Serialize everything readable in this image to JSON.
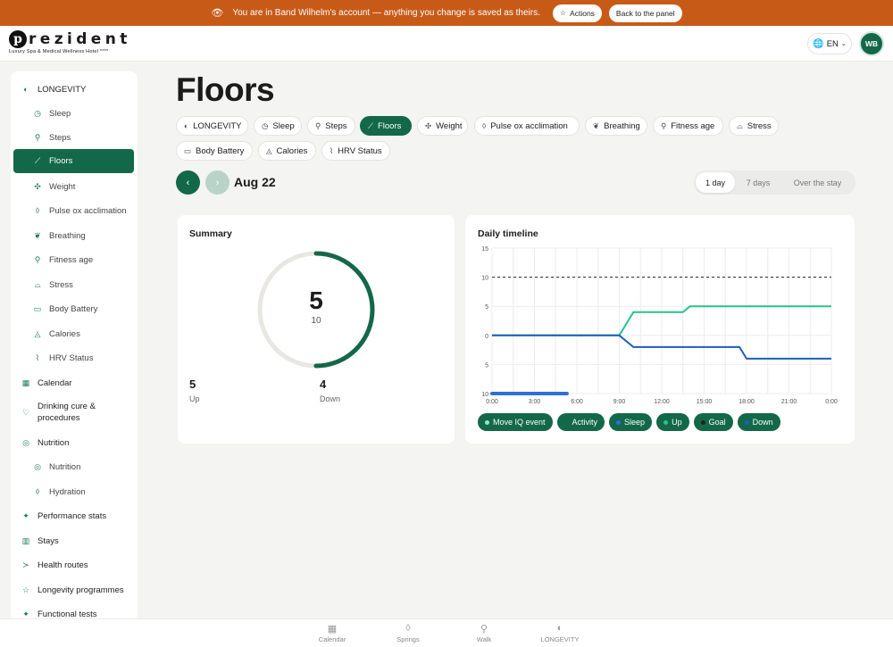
{
  "banner": {
    "message": "You are in Band Wilhelm's account — anything you change is saved as theirs.",
    "actions_label": "Actions",
    "back_label": "Back to the panel"
  },
  "header": {
    "logo_word": "rezident",
    "logo_sub": "Luxury Spa & Medical Wellness Hotel ****",
    "lang": "EN",
    "avatar": "WB"
  },
  "sidebar": {
    "items": [
      {
        "label": "LONGEVITY",
        "icon": "longevity-icon",
        "level": "top"
      },
      {
        "label": "Sleep",
        "icon": "clock-icon",
        "level": "sub"
      },
      {
        "label": "Steps",
        "icon": "walk-icon",
        "level": "sub"
      },
      {
        "label": "Floors",
        "icon": "stairs-icon",
        "level": "sub",
        "active": true
      },
      {
        "label": "Weight",
        "icon": "weight-icon",
        "level": "sub"
      },
      {
        "label": "Pulse ox acclimation",
        "icon": "drop-icon",
        "level": "sub"
      },
      {
        "label": "Breathing",
        "icon": "lungs-icon",
        "level": "sub"
      },
      {
        "label": "Fitness age",
        "icon": "run-icon",
        "level": "sub"
      },
      {
        "label": "Stress",
        "icon": "stress-icon",
        "level": "sub"
      },
      {
        "label": "Body Battery",
        "icon": "battery-icon",
        "level": "sub"
      },
      {
        "label": "Calories",
        "icon": "flame-icon",
        "level": "sub"
      },
      {
        "label": "HRV Status",
        "icon": "pulse-icon",
        "level": "sub"
      },
      {
        "label": "Calendar",
        "icon": "calendar-icon",
        "level": "top"
      },
      {
        "label": "Drinking cure & procedures",
        "icon": "heart-icon",
        "level": "top"
      },
      {
        "label": "Nutrition",
        "icon": "target-icon",
        "level": "top"
      },
      {
        "label": "Nutrition",
        "icon": "target-icon",
        "level": "sub"
      },
      {
        "label": "Hydration",
        "icon": "drop-icon",
        "level": "sub"
      },
      {
        "label": "Performance stats",
        "icon": "sparkle-icon",
        "level": "top"
      },
      {
        "label": "Stays",
        "icon": "building-icon",
        "level": "top"
      },
      {
        "label": "Health routes",
        "icon": "route-icon",
        "level": "top"
      },
      {
        "label": "Longevity programmes",
        "icon": "star-icon",
        "level": "top"
      },
      {
        "label": "Functional tests",
        "icon": "sparkle-icon",
        "level": "top"
      }
    ]
  },
  "main": {
    "title": "Floors",
    "chips": [
      {
        "label": "LONGEVITY"
      },
      {
        "label": "Sleep"
      },
      {
        "label": "Steps"
      },
      {
        "label": "Floors",
        "active": true
      },
      {
        "label": "Weight"
      },
      {
        "label": "Pulse ox acclimation"
      },
      {
        "label": "Breathing"
      },
      {
        "label": "Fitness age"
      },
      {
        "label": "Stress"
      },
      {
        "label": "Body Battery"
      },
      {
        "label": "Calories"
      },
      {
        "label": "HRV Status"
      }
    ],
    "date": "Aug 22",
    "ranges": [
      "1 day",
      "7 days",
      "Over the stay"
    ],
    "selected_range": "1 day"
  },
  "summary": {
    "title": "Summary",
    "value": "5",
    "goal": "10",
    "progress": 0.5,
    "up_value": "5",
    "up_label": "Up",
    "down_value": "4",
    "down_label": "Down"
  },
  "timeline": {
    "title": "Daily timeline",
    "legend": [
      {
        "label": "Move IQ event",
        "color": "#9be3bf"
      },
      {
        "label": "Activity",
        "color": "#13684a"
      },
      {
        "label": "Sleep",
        "color": "#2f6fd6"
      },
      {
        "label": "Up",
        "color": "#2bbf8f"
      },
      {
        "label": "Goal",
        "color": "#222222"
      },
      {
        "label": "Down",
        "color": "#1d5fb8"
      }
    ]
  },
  "chart_data": {
    "type": "line",
    "title": "Daily timeline",
    "x_ticks": [
      "0:00",
      "3:00",
      "6:00",
      "9:00",
      "12:00",
      "15:00",
      "18:00",
      "21:00",
      "0:00"
    ],
    "y_ticks": [
      "15",
      "10",
      "5",
      "0",
      "5",
      "10"
    ],
    "y_tick_values": [
      15,
      10,
      5,
      0,
      -5,
      -10
    ],
    "ylim": [
      -10,
      15
    ],
    "xlim": [
      0,
      24
    ],
    "grid": true,
    "goal": 10,
    "series": [
      {
        "name": "Up",
        "color": "#2bbf8f",
        "x": [
          0,
          9,
          10,
          13.5,
          14,
          24
        ],
        "y": [
          0,
          0,
          4,
          4,
          5,
          5
        ]
      },
      {
        "name": "Down",
        "color": "#1d5fb8",
        "x": [
          0,
          9,
          10,
          17.5,
          18,
          24
        ],
        "y": [
          0,
          0,
          -2,
          -2,
          -4,
          -4
        ]
      },
      {
        "name": "Sleep",
        "color": "#2f6fd6",
        "x": [
          0,
          5.3
        ],
        "y": [
          -10,
          -10
        ]
      }
    ]
  },
  "bottom_nav": {
    "items": [
      {
        "label": "Calendar",
        "icon": "calendar-icon"
      },
      {
        "label": "Springs",
        "icon": "drop-icon"
      },
      {
        "label": "Walk",
        "icon": "walk-icon"
      },
      {
        "label": "LONGEVITY",
        "icon": "longevity-icon"
      }
    ]
  }
}
